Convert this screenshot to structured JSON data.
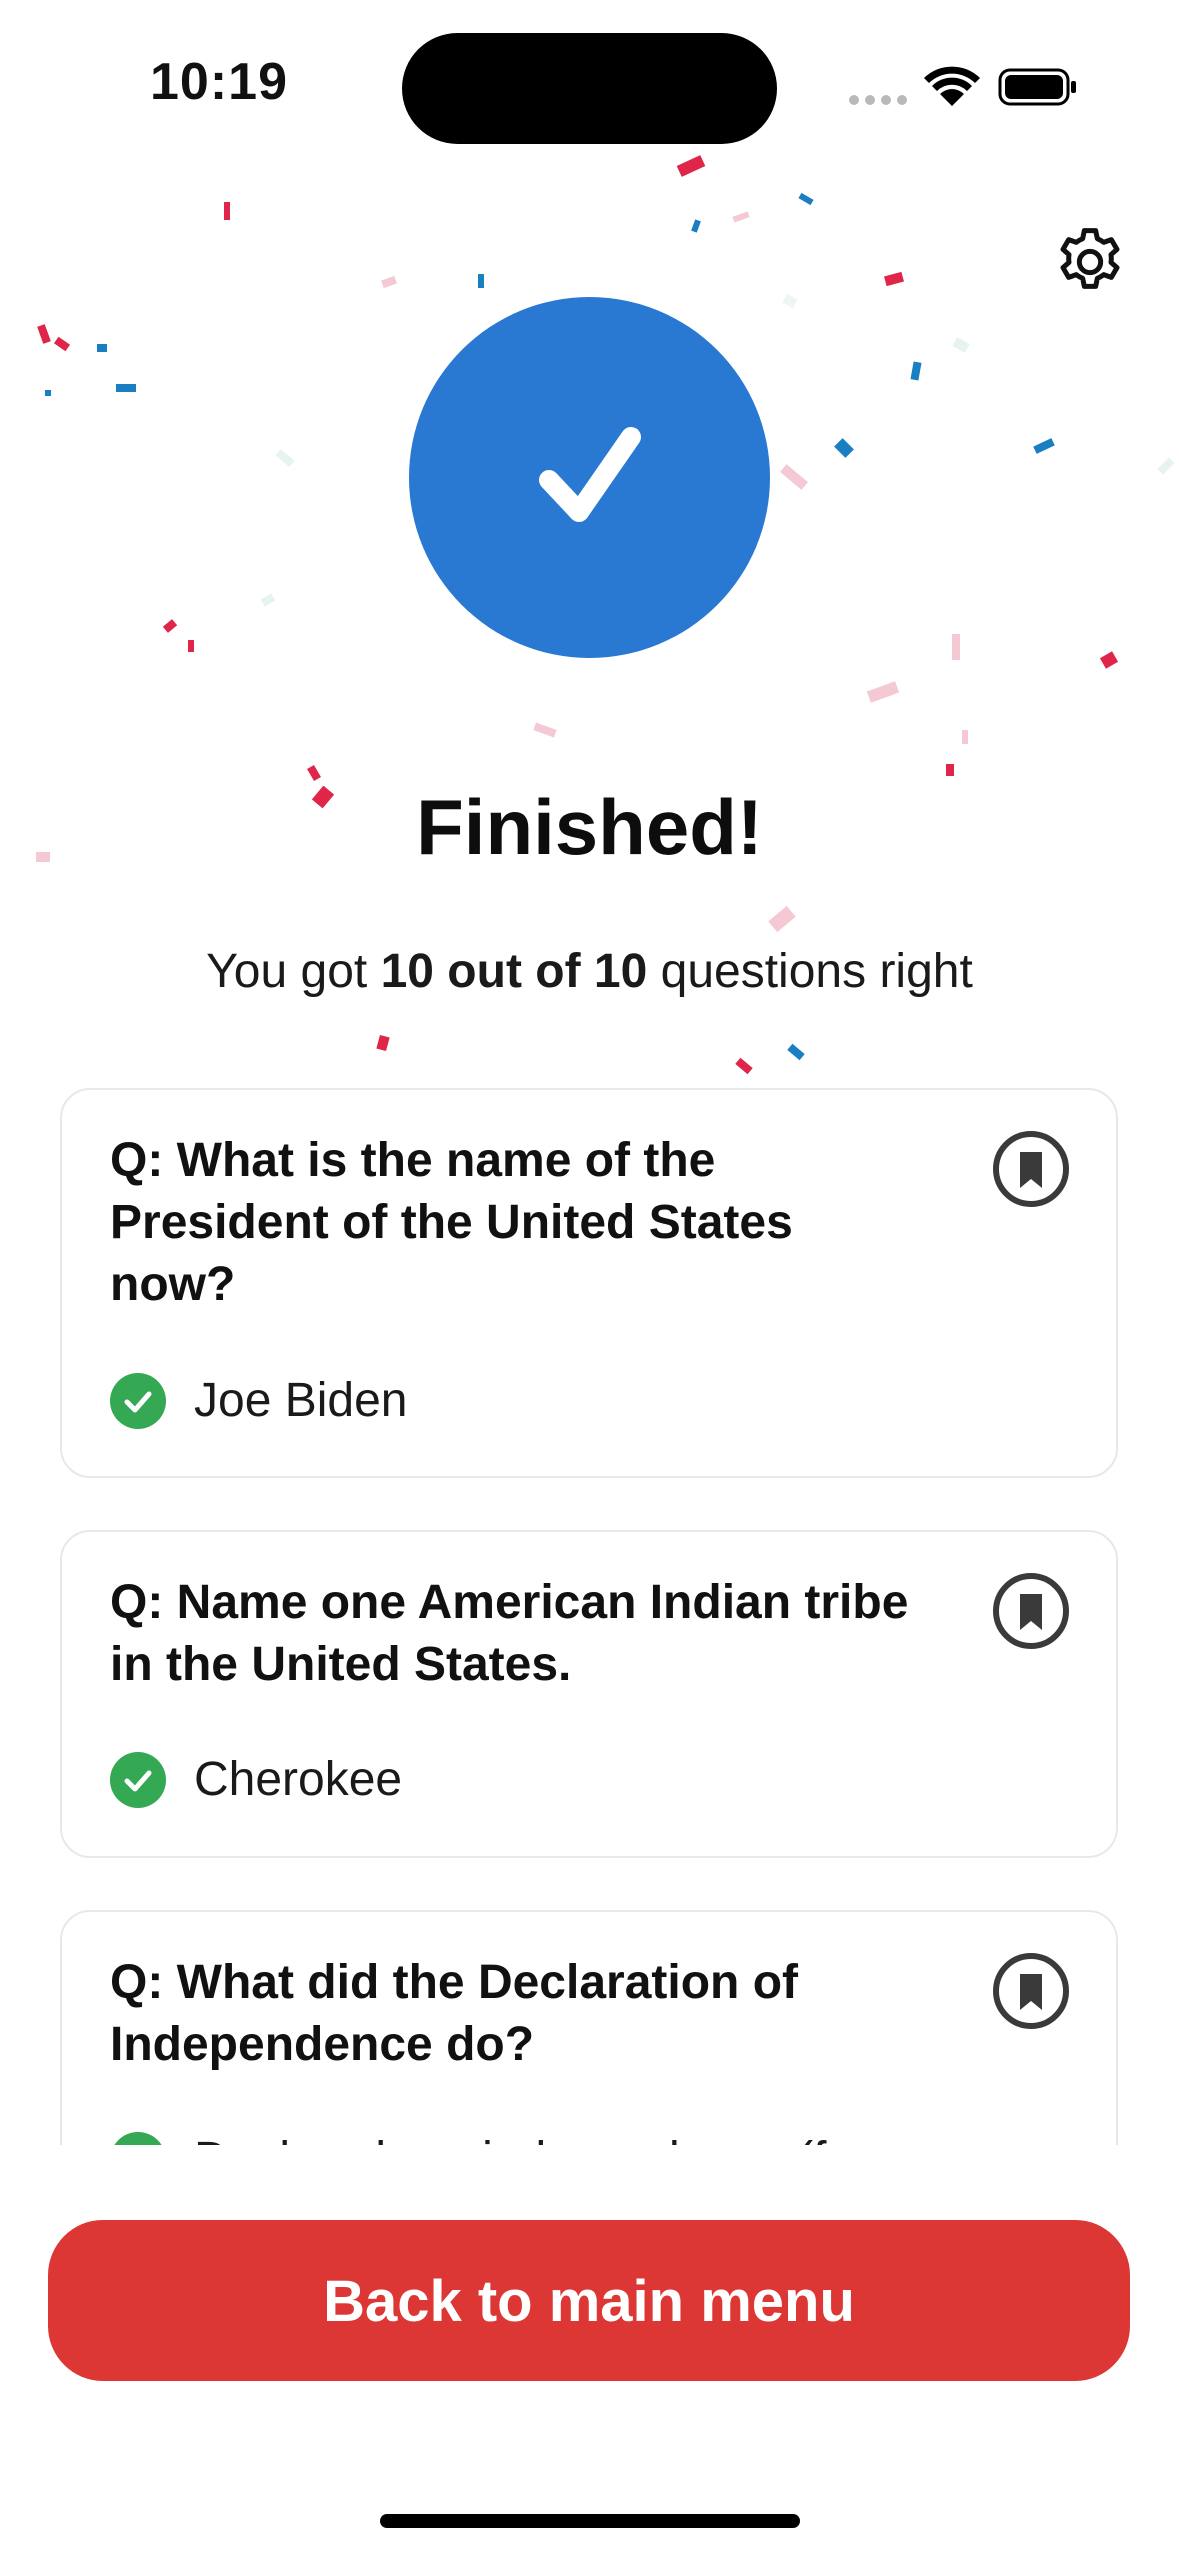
{
  "status_bar": {
    "time": "10:19"
  },
  "result": {
    "title": "Finished!",
    "subtitle_prefix": "You got ",
    "subtitle_score": "10 out of 10",
    "subtitle_suffix": " questions right"
  },
  "questions": [
    {
      "question": "Q: What is the name of the President of the United States now?",
      "answer": "Joe Biden",
      "correct": true
    },
    {
      "question": "Q: Name one American Indian tribe in the United States.",
      "answer": "Cherokee",
      "correct": true
    },
    {
      "question": "Q: What did the Declaration of Independence do?",
      "answer": "Declared our independence (from",
      "correct": true
    }
  ],
  "footer": {
    "button_label": "Back to main menu"
  },
  "colors": {
    "accent_blue": "#2979D3",
    "primary_red": "#DC3734",
    "success_green": "#34A853",
    "confetti_red": "#E0254A",
    "confetti_blue": "#1A7EC2",
    "confetti_pink": "#F4C9D3"
  },
  "icons": {
    "settings": "gear-icon",
    "success": "checkmark-icon",
    "bookmark": "bookmark-icon",
    "answer_correct": "check-circle-icon"
  }
}
